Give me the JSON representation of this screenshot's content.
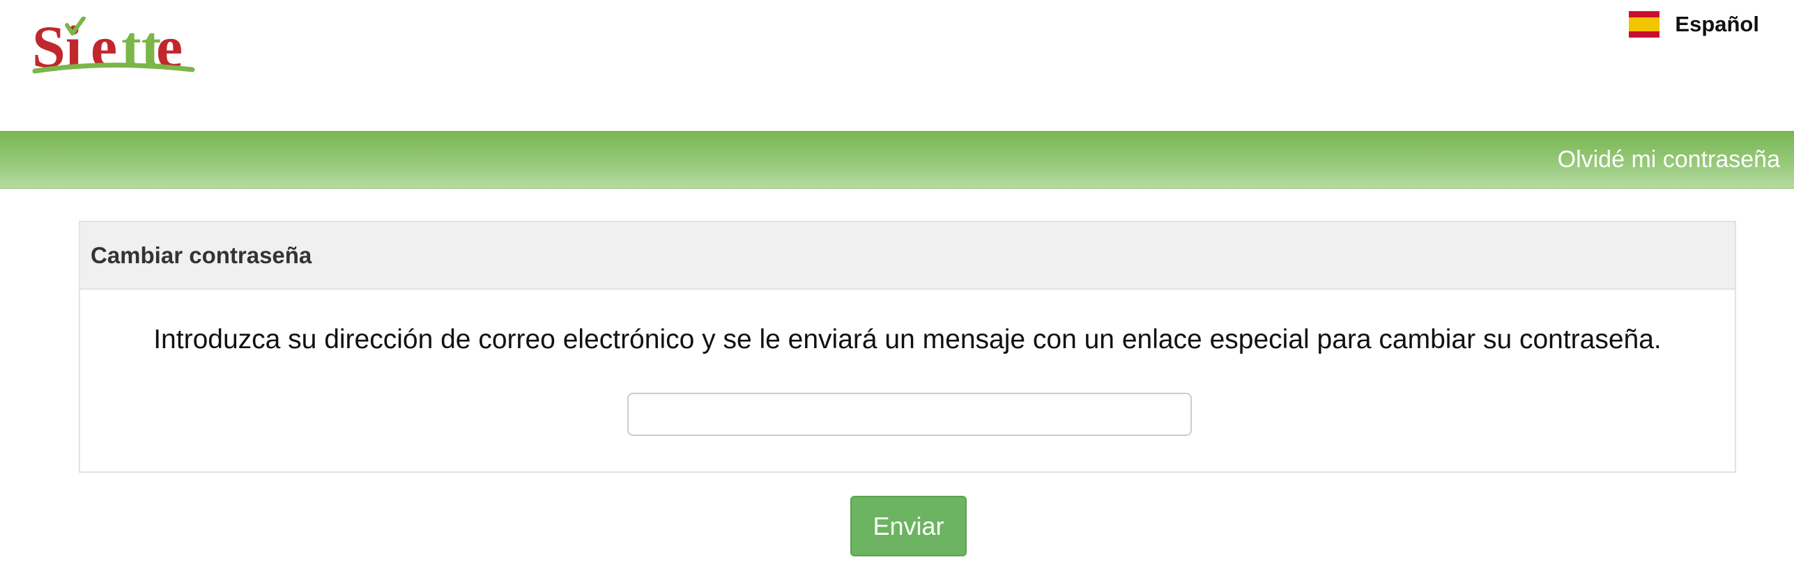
{
  "header": {
    "logo_text": "Siette",
    "language": {
      "label": "Español",
      "flag_icon": "spain-flag-icon"
    }
  },
  "nav": {
    "forgot_password_link": "Olvidé mi contraseña"
  },
  "panel": {
    "title": "Cambiar contraseña",
    "instructions": "Introduzca su dirección de correo electrónico y se le enviará un mensaje con un enlace especial para cambiar su contraseña.",
    "email_value": "",
    "email_placeholder": ""
  },
  "actions": {
    "send_label": "Enviar"
  },
  "colors": {
    "brand_green": "#78b652",
    "logo_red": "#c1272d",
    "button_green": "#6db462"
  }
}
